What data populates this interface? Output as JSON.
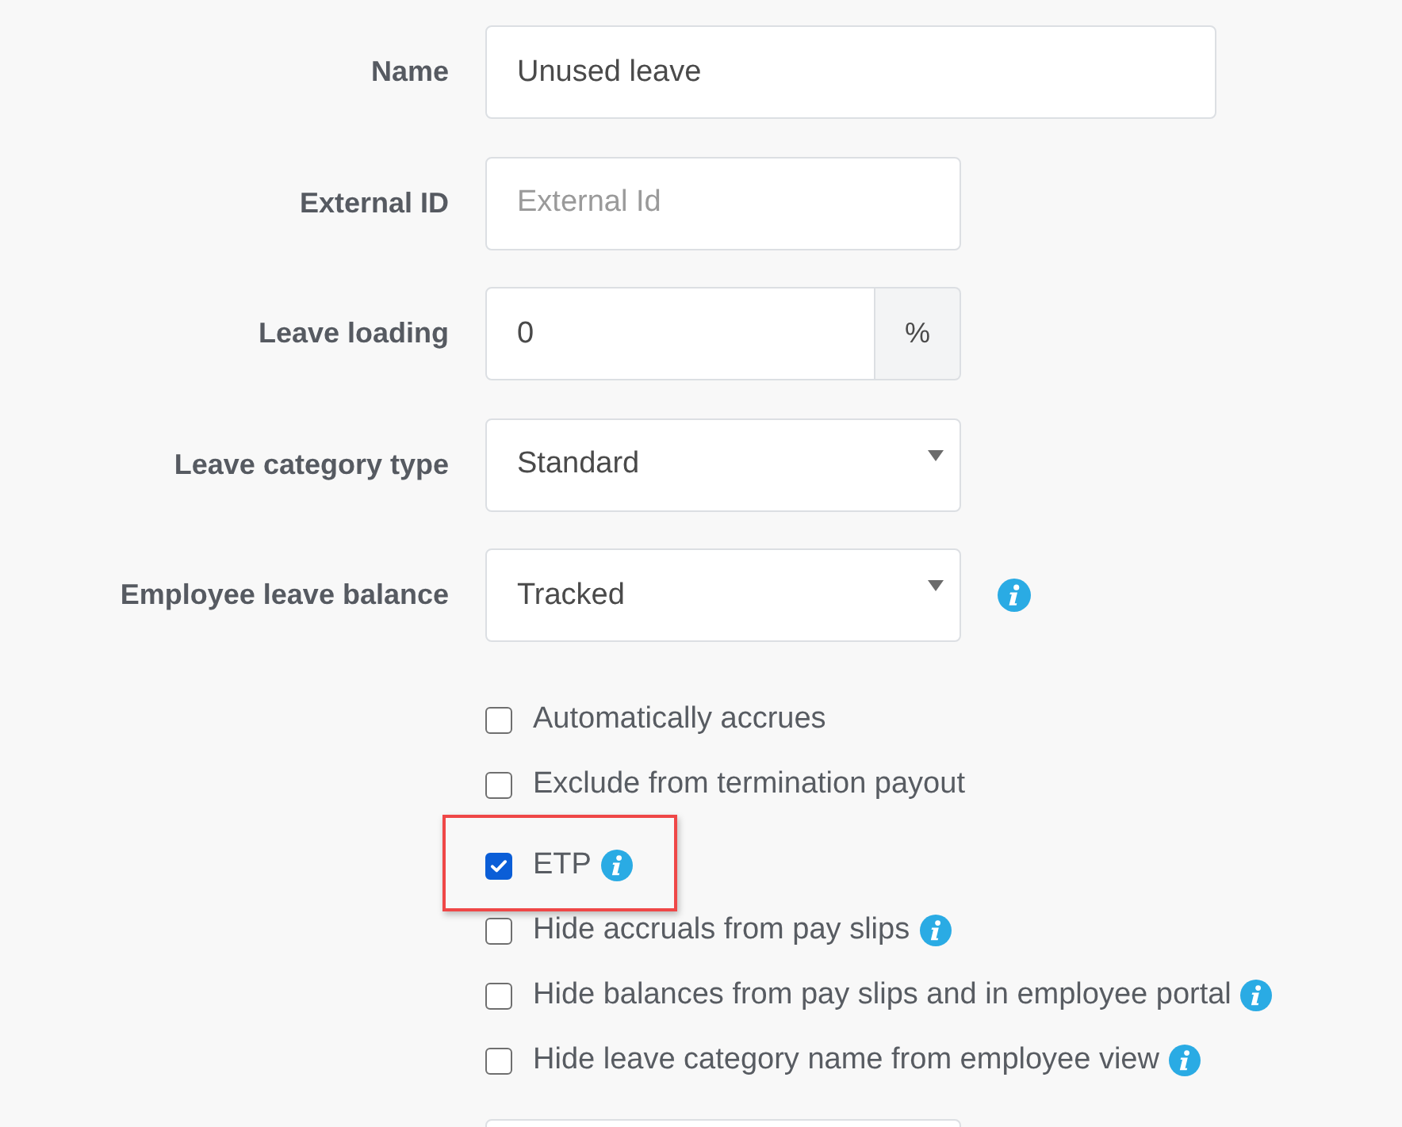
{
  "fields": [
    {
      "label": "Name",
      "kind": "text",
      "value": "Unused leave",
      "info": false
    },
    {
      "label": "External ID",
      "kind": "text",
      "placeholder": "External Id",
      "info": false
    },
    {
      "label": "Leave loading",
      "kind": "addon",
      "value": "0",
      "addon": "%",
      "info": false
    },
    {
      "label": "Leave category type",
      "kind": "select",
      "value": "Standard",
      "info": false
    },
    {
      "label": "Employee leave balance",
      "kind": "select",
      "value": "Tracked",
      "info": true
    }
  ],
  "options": [
    {
      "label": "Automatically accrues",
      "checked": false,
      "info": false,
      "highlighted": false
    },
    {
      "label": "Exclude from termination payout",
      "checked": false,
      "info": false,
      "highlighted": false
    },
    {
      "label": "ETP",
      "checked": true,
      "info": true,
      "highlighted": true
    },
    {
      "label": "Hide accruals from pay slips",
      "checked": false,
      "info": true,
      "highlighted": false
    },
    {
      "label": "Hide balances from pay slips and in employee portal",
      "checked": false,
      "info": true,
      "highlighted": false
    },
    {
      "label": "Hide leave category name from employee view",
      "checked": false,
      "info": true,
      "highlighted": false
    }
  ],
  "next_field": {
    "kind": "text"
  }
}
